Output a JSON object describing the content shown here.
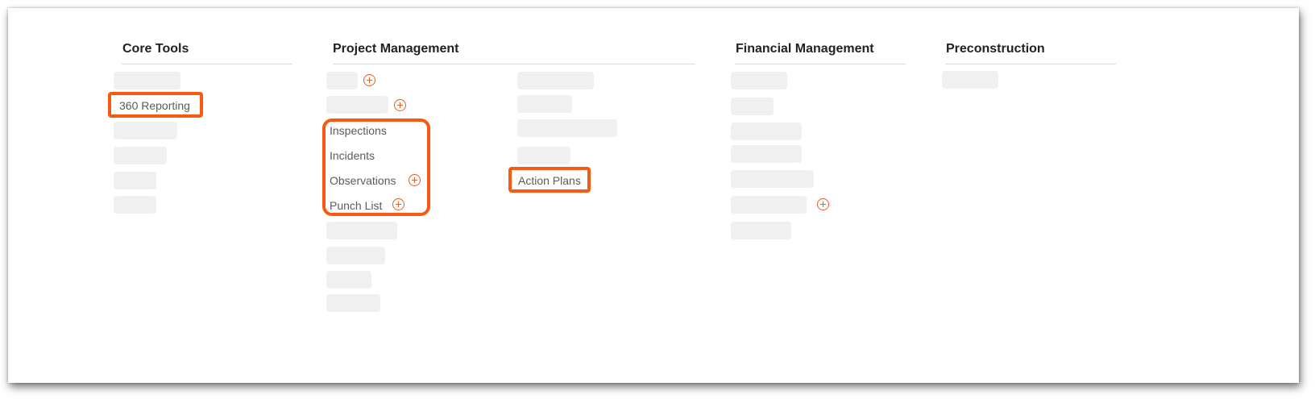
{
  "columns": {
    "core_tools": {
      "heading": "Core Tools",
      "items": [
        "360 Reporting"
      ]
    },
    "project_management": {
      "heading": "Project Management",
      "items": [
        "Inspections",
        "Incidents",
        "Observations",
        "Punch List",
        "Action Plans"
      ]
    },
    "financial_management": {
      "heading": "Financial Management"
    },
    "preconstruction": {
      "heading": "Preconstruction"
    }
  },
  "colors": {
    "accent": "#f65a14",
    "placeholder": "#f0f0f0"
  },
  "icons": {
    "add": "plus-circle-icon"
  }
}
